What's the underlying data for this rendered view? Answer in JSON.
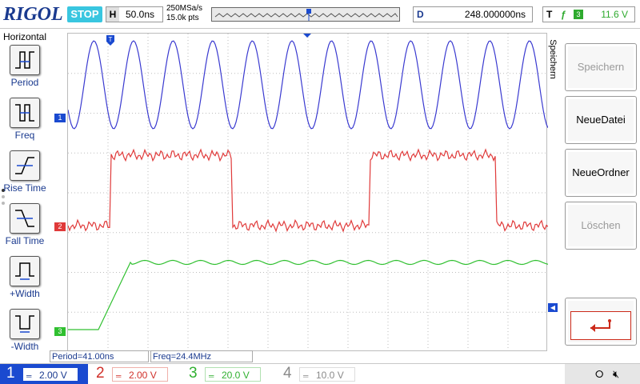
{
  "brand": "RIGOL",
  "run_state": "STOP",
  "timebase": {
    "tag": "H",
    "value": "50.0ns"
  },
  "sampling": {
    "rate": "250MSa/s",
    "points": "15.0k pts"
  },
  "delay": {
    "tag": "D",
    "value": "248.000000ns"
  },
  "trigger": {
    "tag": "T",
    "edge": "ƒ",
    "source": "3",
    "level": "11.6 V",
    "color": "#2eaa2e"
  },
  "left_menu": {
    "title": "Horizontal",
    "items": [
      {
        "label": "Period",
        "icon": "period-icon"
      },
      {
        "label": "Freq",
        "icon": "frequency-icon"
      },
      {
        "label": "Rise Time",
        "icon": "rise-time-icon"
      },
      {
        "label": "Fall Time",
        "icon": "fall-time-icon"
      },
      {
        "label": "+Width",
        "icon": "positive-width-icon"
      },
      {
        "label": "-Width",
        "icon": "negative-width-icon"
      }
    ]
  },
  "right_menu": {
    "title": "Speichern",
    "buttons": [
      {
        "label": "Speichern",
        "enabled": false
      },
      {
        "label": "NeueDatei",
        "enabled": true
      },
      {
        "label": "NeueOrdner",
        "enabled": true
      },
      {
        "label": "Löschen",
        "enabled": false
      }
    ],
    "back_icon": "return-arrow-icon"
  },
  "readouts": {
    "period": "Period=41.00ns",
    "freq": "Freq=24.4MHz"
  },
  "channels": [
    {
      "num": "1",
      "scale": "2.00 V",
      "color": "#3a3ad0",
      "marker": "1"
    },
    {
      "num": "2",
      "scale": "2.00 V",
      "color": "#e03a3a",
      "marker": "2"
    },
    {
      "num": "3",
      "scale": "20.0 V",
      "color": "#30c030",
      "marker": "3"
    },
    {
      "num": "4",
      "scale": "10.0 V",
      "color": "#8a8a8a"
    }
  ],
  "trigger_level_marker": "◀",
  "status_icons": [
    "usb-icon",
    "speaker-mute-icon"
  ],
  "colors": {
    "ch1": "#3a3ad0",
    "ch2": "#e03a3a",
    "ch3": "#30c030",
    "accent": "#39c6e0",
    "brand": "#1a3a8f"
  }
}
